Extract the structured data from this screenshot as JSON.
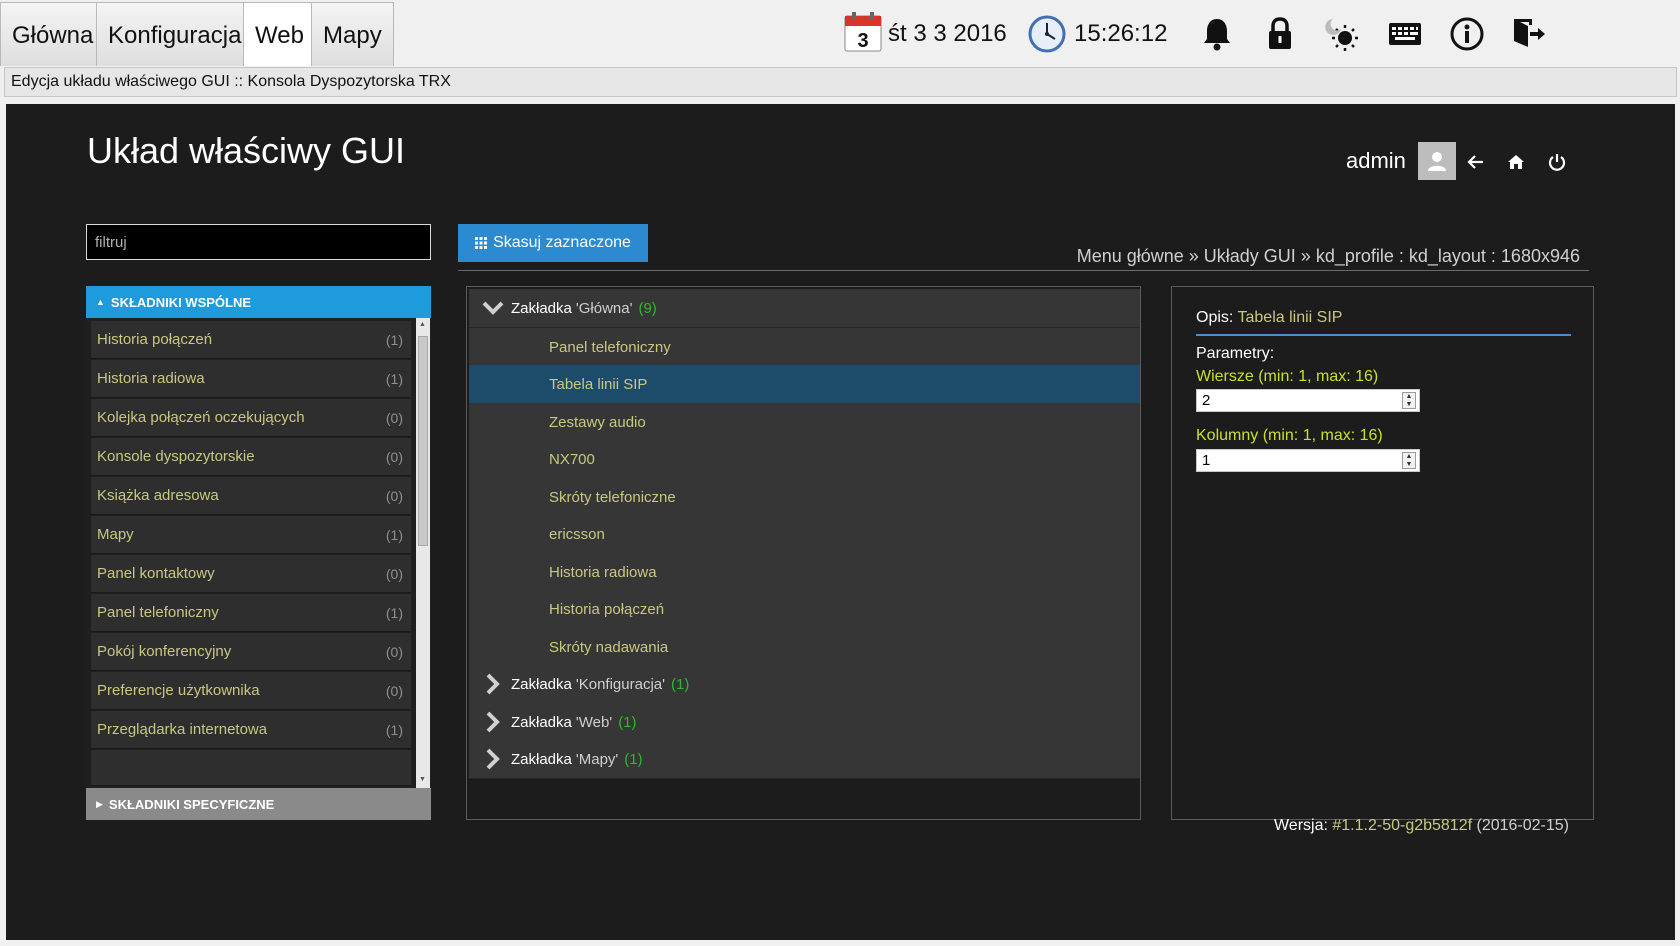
{
  "top_tabs": [
    {
      "label": "Główna",
      "active": false
    },
    {
      "label": "Konfiguracja",
      "active": false
    },
    {
      "label": "Web",
      "active": true
    },
    {
      "label": "Mapy",
      "active": false
    }
  ],
  "status": {
    "calendar_day": "3",
    "date": "śt 3 3 2016",
    "time": "15:26:12"
  },
  "window_title": "Edycja układu właściwego GUI :: Konsola Dyspozytorska TRX",
  "page": {
    "title": "Układ właściwy GUI",
    "user": "admin",
    "filter_placeholder": "filtruj",
    "delete_button": "Skasuj zaznaczone",
    "breadcrumb": "Menu główne » Układy GUI » kd_profile : kd_layout : 1680x946"
  },
  "left_panel": {
    "section_common": "SKŁADNIKI WSPÓLNE",
    "section_specific": "SKŁADNIKI SPECYFICZNE",
    "items": [
      {
        "label": "Historia połączeń",
        "count": "(1)"
      },
      {
        "label": "Historia radiowa",
        "count": "(1)"
      },
      {
        "label": "Kolejka połączeń oczekujących",
        "count": "(0)"
      },
      {
        "label": "Konsole dyspozytorskie",
        "count": "(0)"
      },
      {
        "label": "Książka adresowa",
        "count": "(0)"
      },
      {
        "label": "Mapy",
        "count": "(1)"
      },
      {
        "label": "Panel kontaktowy",
        "count": "(0)"
      },
      {
        "label": "Panel telefoniczny",
        "count": "(1)"
      },
      {
        "label": "Pokój konferencyjny",
        "count": "(0)"
      },
      {
        "label": "Preferencje użytkownika",
        "count": "(0)"
      },
      {
        "label": "Przeglądarka internetowa",
        "count": "(1)"
      }
    ]
  },
  "tree": {
    "tab_word": "Zakładka",
    "tabs": [
      {
        "name": "'Główna'",
        "count": "(9)",
        "expanded": true,
        "children": [
          "Panel telefoniczny",
          "Tabela linii SIP",
          "Zestawy audio",
          "NX700",
          "Skróty telefoniczne",
          "ericsson",
          "Historia radiowa",
          "Historia połączeń",
          "Skróty nadawania"
        ],
        "selected_child": "Tabela linii SIP"
      },
      {
        "name": "'Konfiguracja'",
        "count": "(1)",
        "expanded": false
      },
      {
        "name": "'Web'",
        "count": "(1)",
        "expanded": false
      },
      {
        "name": "'Mapy'",
        "count": "(1)",
        "expanded": false
      }
    ]
  },
  "details": {
    "opis_label": "Opis:",
    "opis_value": "Tabela linii SIP",
    "params_label": "Parametry:",
    "rows_label": "Wiersze (min: 1, max: 16)",
    "rows_value": "2",
    "cols_label": "Kolumny (min: 1, max: 16)",
    "cols_value": "1"
  },
  "version": {
    "label": "Wersja:",
    "value": "#1.1.2-50-g2b5812f",
    "date": "(2016-02-15)"
  },
  "colors": {
    "accent_blue": "#1e9bdc",
    "button_blue": "#2c8ad0",
    "item_text": "#c8c880",
    "count_green": "#2eb82e",
    "param_label": "#c8e028",
    "selected_row": "#1d4b6a"
  }
}
